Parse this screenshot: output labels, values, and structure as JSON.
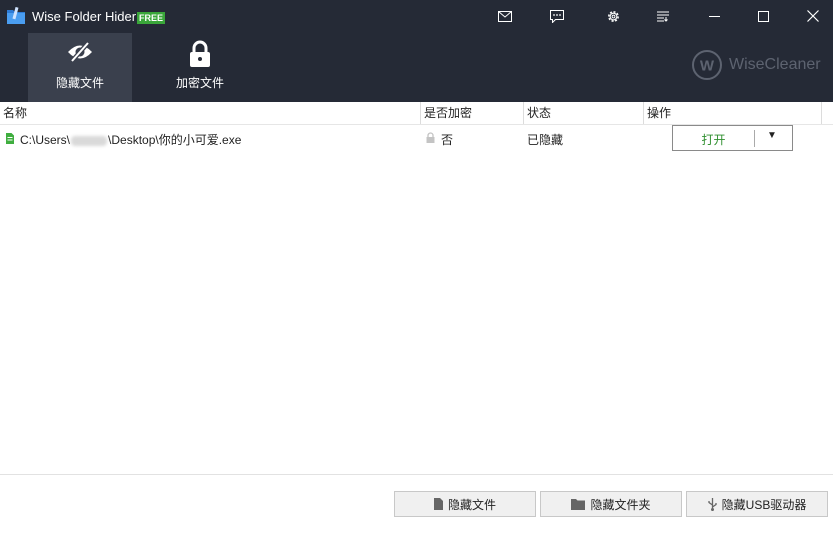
{
  "app": {
    "title": "Wise Folder Hider",
    "badge": "FREE",
    "brand": "WiseCleaner"
  },
  "titlebar_icons": [
    "mail-icon",
    "chat-icon",
    "settings-icon",
    "menu-icon",
    "minimize-icon",
    "maximize-icon",
    "close-icon"
  ],
  "nav": {
    "tabs": [
      {
        "label": "隐藏文件",
        "icon": "eye-slash-icon",
        "active": true
      },
      {
        "label": "加密文件",
        "icon": "lock-icon",
        "active": false
      }
    ]
  },
  "table": {
    "columns": [
      "名称",
      "是否加密",
      "状态",
      "操作"
    ],
    "rows": [
      {
        "path_prefix": "C:\\Users\\",
        "path_suffix": "\\Desktop\\你的小可爱.exe",
        "encrypted": "否",
        "status": "已隐藏",
        "action": "打开"
      }
    ]
  },
  "footer": {
    "hide_file": "隐藏文件",
    "hide_folder": "隐藏文件夹",
    "hide_usb": "隐藏USB驱动器"
  },
  "colors": {
    "header_bg": "#252a36",
    "active_tab_bg": "#3a404d",
    "badge": "#3aa63a",
    "action_text": "#2f8f2f"
  }
}
